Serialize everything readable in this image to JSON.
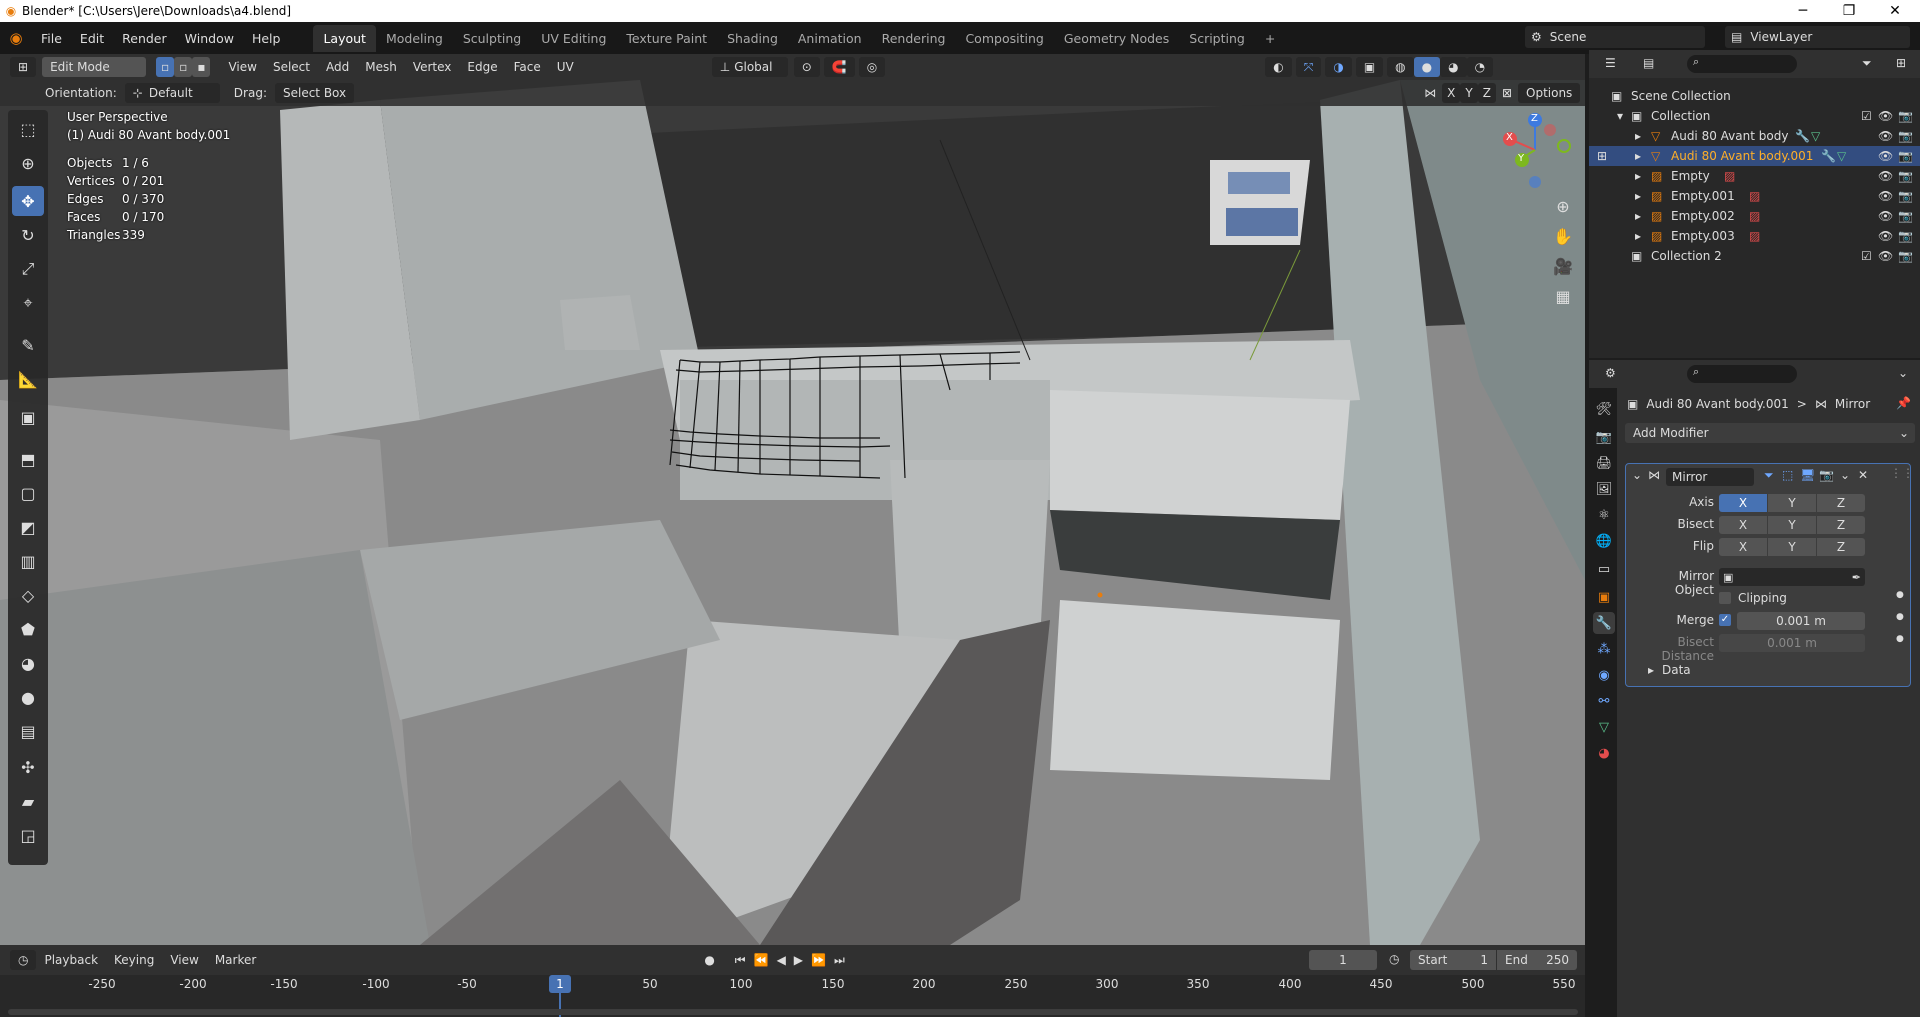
{
  "window": {
    "title": "Blender* [C:\\Users\\Jere\\Downloads\\a4.blend]",
    "minimize": "─",
    "maximize": "❐",
    "close": "✕"
  },
  "menu": [
    "File",
    "Edit",
    "Render",
    "Window",
    "Help"
  ],
  "workspaces": [
    "Layout",
    "Modeling",
    "Sculpting",
    "UV Editing",
    "Texture Paint",
    "Shading",
    "Animation",
    "Rendering",
    "Compositing",
    "Geometry Nodes",
    "Scripting",
    "+"
  ],
  "scene": {
    "name": "Scene",
    "view_layer": "ViewLayer"
  },
  "viewport_header": {
    "mode": "Edit Mode",
    "menus": [
      "View",
      "Select",
      "Add",
      "Mesh",
      "Vertex",
      "Edge",
      "Face",
      "UV"
    ],
    "transform": "Global",
    "orientation_label": "Orientation:",
    "orientation_value": "Default",
    "drag_label": "Drag:",
    "drag_value": "Select Box",
    "axes": [
      "X",
      "Y",
      "Z"
    ],
    "options": "Options"
  },
  "viewport": {
    "view_name": "User Perspective",
    "object_name": "(1) Audi 80 Avant body.001",
    "stats": [
      {
        "label": "Objects",
        "value": "1 / 6"
      },
      {
        "label": "Vertices",
        "value": "0 / 201"
      },
      {
        "label": "Edges",
        "value": "0 / 370"
      },
      {
        "label": "Faces",
        "value": "0 / 170"
      },
      {
        "label": "Triangles",
        "value": "339"
      }
    ],
    "gizmo_axes": {
      "x": "X",
      "y": "Y",
      "z": "Z"
    },
    "colors": {
      "x": "#e34d4d",
      "y": "#7db81f",
      "z": "#3d7ae0"
    }
  },
  "outliner": {
    "root": "Scene Collection",
    "items": [
      {
        "name": "Collection",
        "level": 1,
        "selected": false
      },
      {
        "name": "Audi 80 Avant body",
        "level": 2,
        "selected": false
      },
      {
        "name": "Audi 80 Avant body.001",
        "level": 2,
        "selected": true
      },
      {
        "name": "Empty",
        "level": 2,
        "selected": false
      },
      {
        "name": "Empty.001",
        "level": 2,
        "selected": false
      },
      {
        "name": "Empty.002",
        "level": 2,
        "selected": false
      },
      {
        "name": "Empty.003",
        "level": 2,
        "selected": false
      },
      {
        "name": "Collection 2",
        "level": 1,
        "selected": false
      }
    ]
  },
  "properties": {
    "breadcrumb_object": "Audi 80 Avant body.001",
    "breadcrumb_sep": ">",
    "breadcrumb_modifier": "Mirror",
    "add_modifier": "Add Modifier",
    "modifier_name": "Mirror",
    "axis_label": "Axis",
    "bisect_label": "Bisect",
    "flip_label": "Flip",
    "mirror_object_label": "Mirror Object",
    "clipping_label": "Clipping",
    "merge_label": "Merge",
    "merge_value": "0.001 m",
    "bisect_distance_label": "Bisect Distance",
    "bisect_distance_value": "0.001 m",
    "data_label": "Data",
    "xyz": [
      "X",
      "Y",
      "Z"
    ]
  },
  "timeline": {
    "menus": [
      "Playback",
      "Keying",
      "View",
      "Marker"
    ],
    "current_frame": "1",
    "start_label": "Start",
    "start": "1",
    "end_label": "End",
    "end": "250",
    "ticks": [
      "-250",
      "-200",
      "-150",
      "-100",
      "-50",
      "1",
      "50",
      "100",
      "150",
      "200",
      "250",
      "300",
      "350",
      "400",
      "450",
      "500",
      "550"
    ],
    "playhead": "1"
  }
}
